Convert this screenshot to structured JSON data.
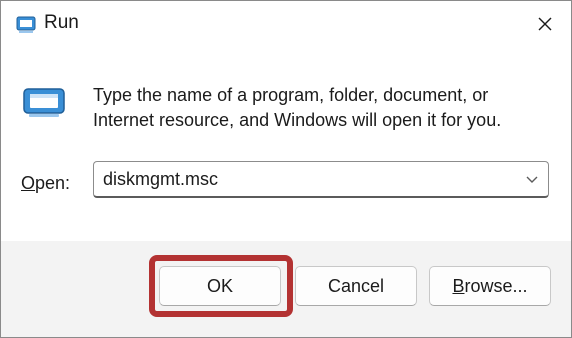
{
  "window": {
    "title": "Run",
    "close_glyph": "✕"
  },
  "prompt": {
    "line1": "Type the name of a program, folder, document, or",
    "line2": "Internet resource, and Windows will open it for you."
  },
  "open": {
    "label_prefix": "",
    "label_underlined": "O",
    "label_rest": "pen:",
    "value": "diskmgmt.msc"
  },
  "buttons": {
    "ok": "OK",
    "cancel": "Cancel",
    "browse_underlined": "B",
    "browse_rest": "rowse..."
  },
  "colors": {
    "highlight": "#b33232",
    "icon_blue": "#3a8fd6"
  },
  "icons": {
    "title": "run-app-icon",
    "dialog": "run-app-icon",
    "close": "close-icon",
    "dropdown": "chevron-down-icon"
  }
}
